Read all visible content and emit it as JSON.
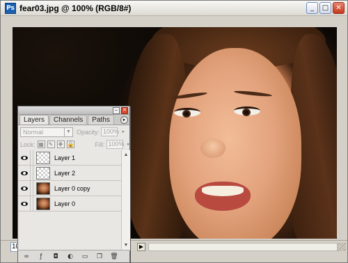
{
  "document": {
    "app_icon": "Ps",
    "title": "fear03.jpg @ 100% (RGB/8#)",
    "window_buttons": {
      "minimize": "_",
      "maximize": "□",
      "close": "✕"
    },
    "zoom_field": "100%"
  },
  "layers_panel": {
    "tabs": [
      "Layers",
      "Channels",
      "Paths"
    ],
    "active_tab": "Layers",
    "blend_mode": "Normal",
    "opacity_label": "Opacity:",
    "opacity_value": "100%",
    "lock_label": "Lock:",
    "fill_label": "Fill:",
    "fill_value": "100%",
    "layers": [
      {
        "name": "Layer 1",
        "visible": true,
        "thumbnail": "transparent"
      },
      {
        "name": "Layer 2",
        "visible": true,
        "thumbnail": "transparent"
      },
      {
        "name": "Layer 0 copy",
        "visible": true,
        "thumbnail": "photo"
      },
      {
        "name": "Layer 0",
        "visible": true,
        "thumbnail": "photo"
      }
    ],
    "bottom_tools": [
      "link-layers-icon",
      "layer-style-icon",
      "layer-mask-icon",
      "adjustment-layer-icon",
      "new-group-icon",
      "new-layer-icon",
      "delete-layer-icon"
    ]
  },
  "colors": {
    "palette_bg": "#e9e7e4",
    "close_red": "#d64b30",
    "title_blue": "#1a5fb0"
  }
}
